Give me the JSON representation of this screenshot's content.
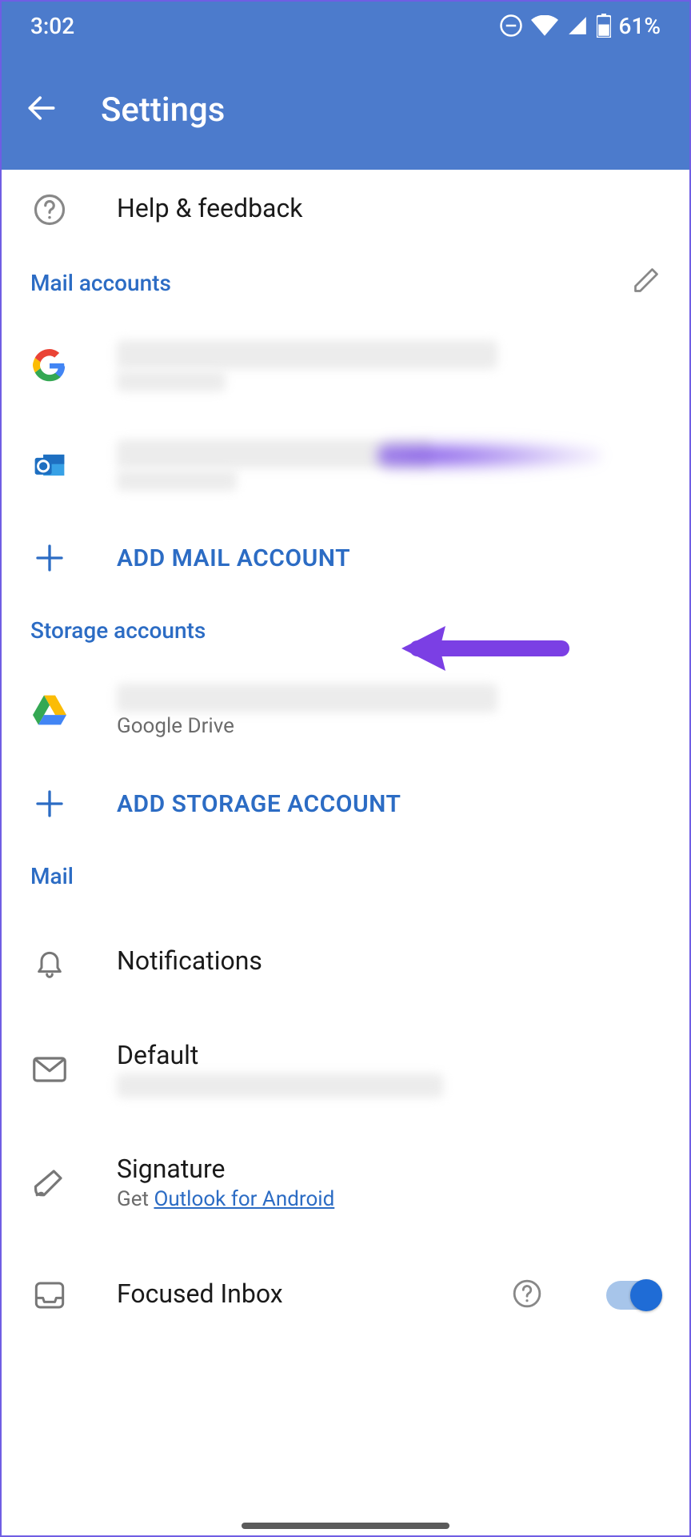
{
  "status": {
    "time": "3:02",
    "battery": "61%"
  },
  "appbar": {
    "title": "Settings"
  },
  "help": {
    "label": "Help & feedback"
  },
  "sections": {
    "mail_accounts": {
      "title": "Mail accounts"
    },
    "storage_accounts": {
      "title": "Storage accounts"
    },
    "mail": {
      "title": "Mail"
    }
  },
  "add_mail": {
    "label": "ADD MAIL ACCOUNT"
  },
  "add_storage": {
    "label": "ADD STORAGE ACCOUNT"
  },
  "storage_item": {
    "sub": "Google Drive"
  },
  "notifications": {
    "label": "Notifications"
  },
  "default": {
    "label": "Default"
  },
  "signature": {
    "label": "Signature",
    "sub_prefix": "Get ",
    "link": "Outlook for Android"
  },
  "focused_inbox": {
    "label": "Focused Inbox"
  }
}
